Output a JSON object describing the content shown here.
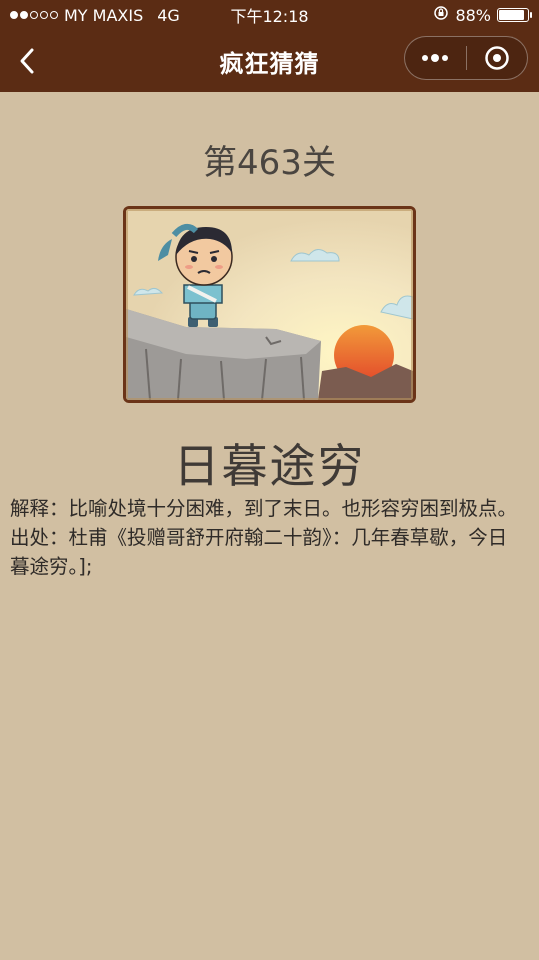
{
  "status_bar": {
    "carrier": "MY MAXIS",
    "network": "4G",
    "time": "下午12:18",
    "battery": "88%",
    "battery_level": 0.88,
    "signal_strength": 2,
    "signal_max": 5
  },
  "navbar": {
    "title": "疯狂猜猜",
    "back_icon": "chevron-left-icon",
    "more_icon": "more-dots-icon",
    "close_icon": "target-circle-icon"
  },
  "level": {
    "label": "第463关"
  },
  "idiom": {
    "text": "日暮途穷"
  },
  "explanation": {
    "meaning": "解释：比喻处境十分困难，到了末日。也形容穷困到极点。",
    "source": "出处：杜甫《投赠哥舒开府翰二十韵》：几年春草歇，今日暮途穷。];"
  },
  "colors": {
    "header_bg": "#5b2c14",
    "page_bg": "#d1bfa2",
    "frame": "#6b3418"
  }
}
